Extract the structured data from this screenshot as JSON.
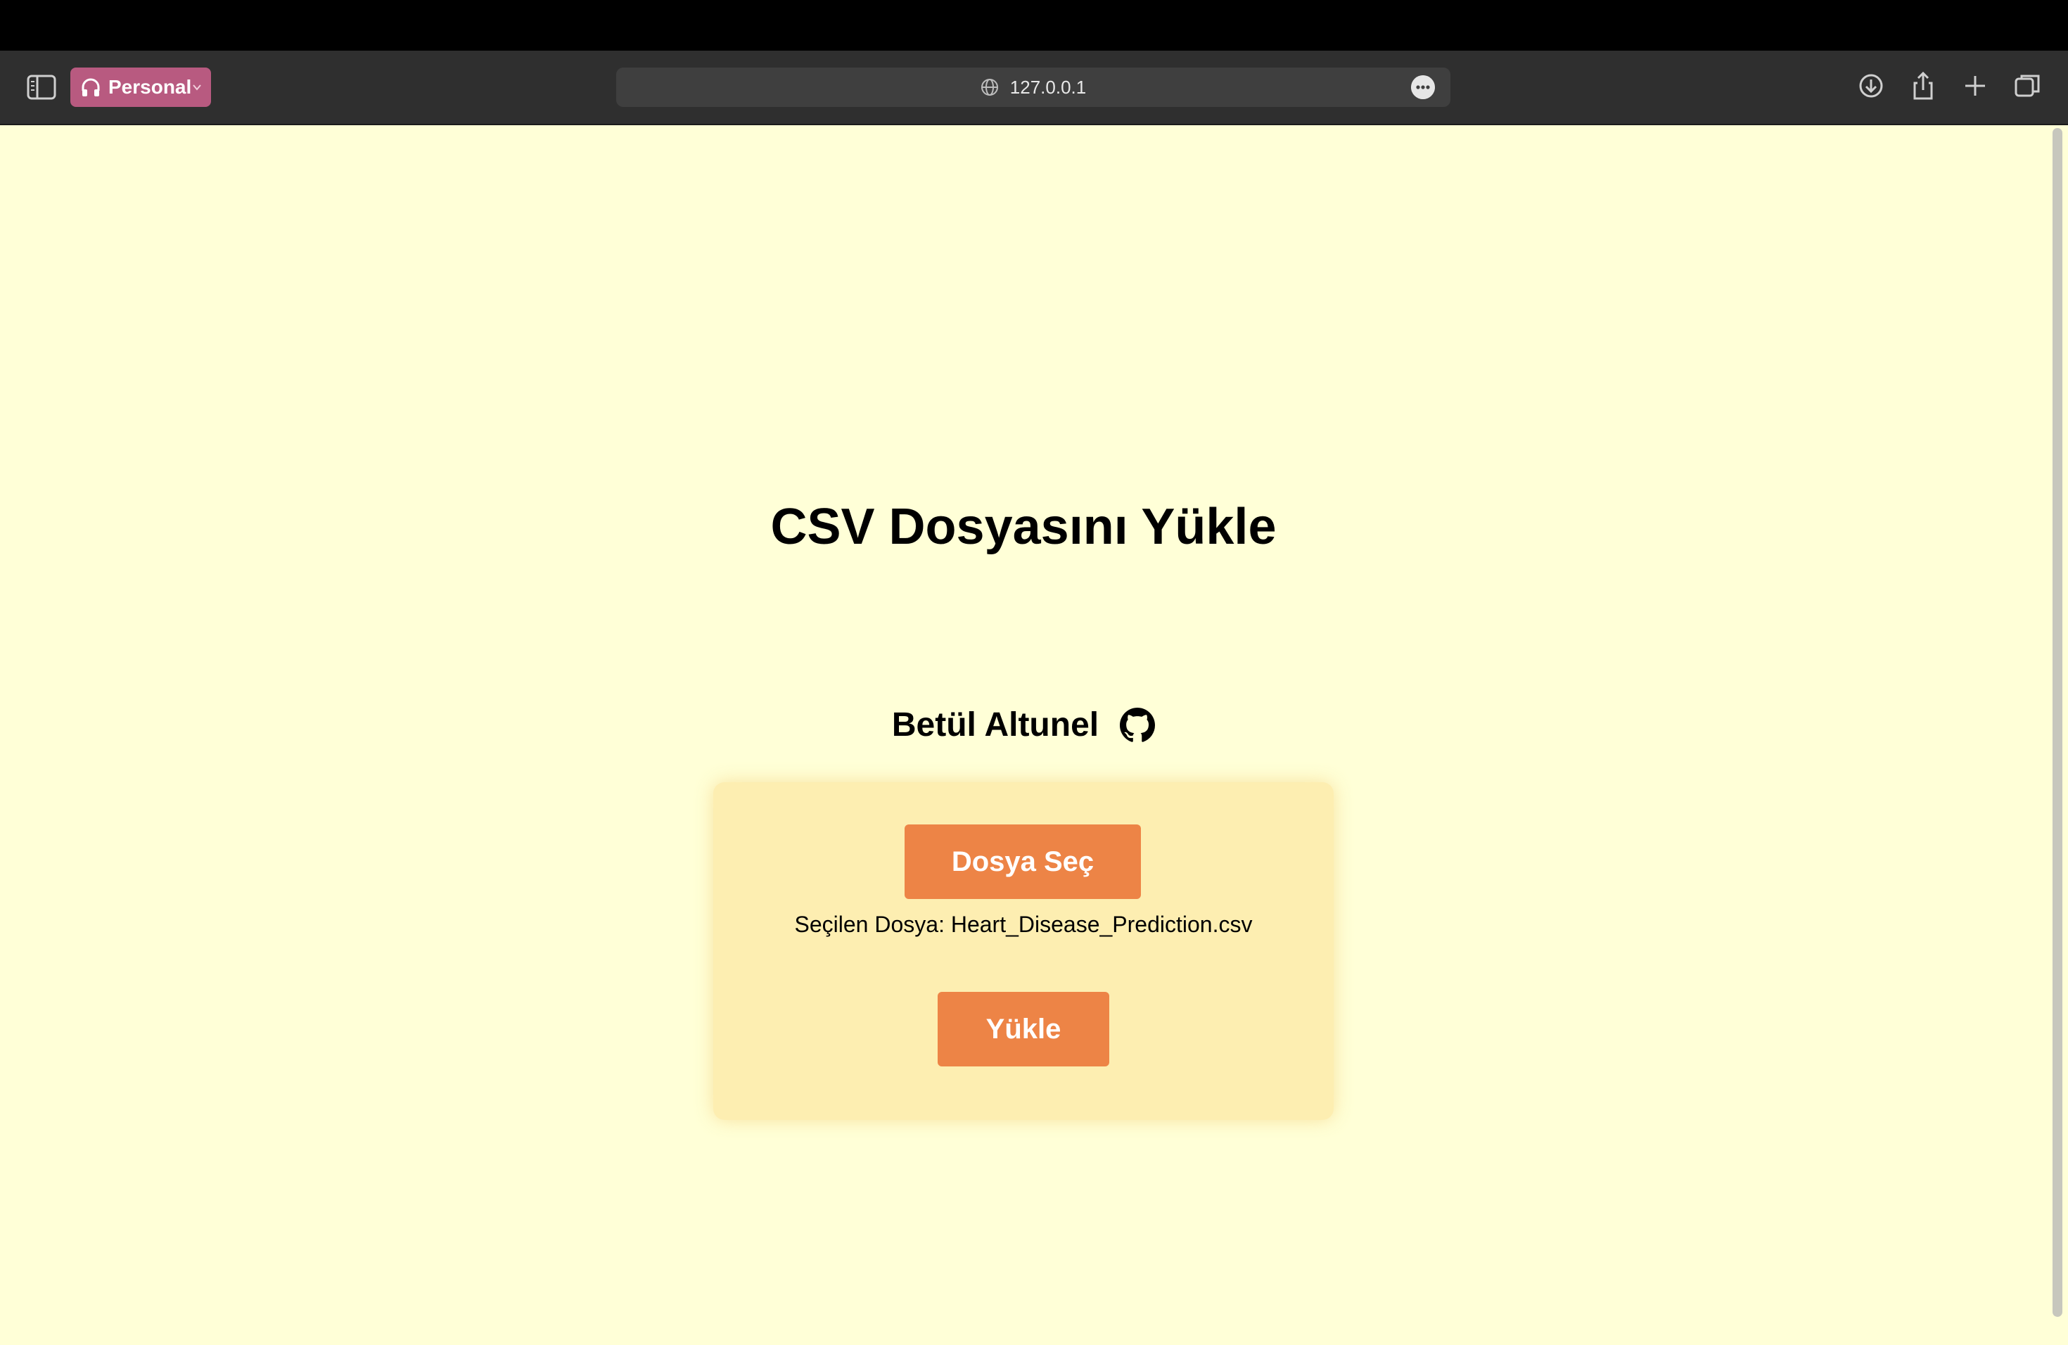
{
  "browser": {
    "profile_label": "Personal",
    "address": "127.0.0.1",
    "icons": [
      "sidebar-toggle-icon",
      "headphones-icon",
      "chevron-down-icon",
      "globe-icon",
      "more-icon",
      "download-icon",
      "share-icon",
      "new-tab-icon",
      "tab-overview-icon"
    ]
  },
  "page": {
    "title": "CSV Dosyasını Yükle",
    "author": "Betül Altunel",
    "author_icon": "github-icon",
    "background_color": "#ffffd7",
    "card_color": "#fdeeb1",
    "accent_color": "#ed8446"
  },
  "upload_form": {
    "choose_button_label": "Dosya Seç",
    "selected_file_text": "Seçilen Dosya: Heart_Disease_Prediction.csv",
    "upload_button_label": "Yükle"
  }
}
